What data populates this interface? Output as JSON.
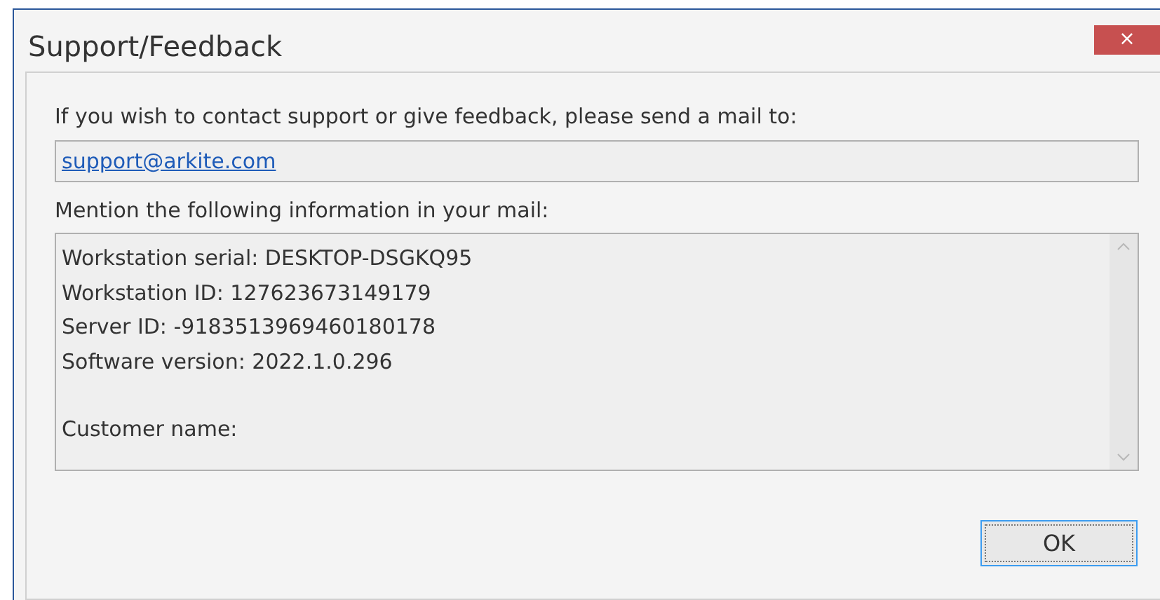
{
  "window": {
    "title": "Support/Feedback",
    "close": "×"
  },
  "contact_prompt": "If you wish to contact support or give feedback, please send a mail to:",
  "email_link": "support@arkite.com",
  "info_prompt": "Mention the following information in your mail:",
  "info_box": {
    "lines": [
      "Workstation serial: DESKTOP-DSGKQ95",
      "Workstation ID: 127623673149179",
      "Server ID: -9183513969460180178",
      "Software version: 2022.1.0.296"
    ],
    "customer_line": "Customer name:"
  },
  "buttons": [
    {
      "label": "OK",
      "focused": true
    }
  ]
}
